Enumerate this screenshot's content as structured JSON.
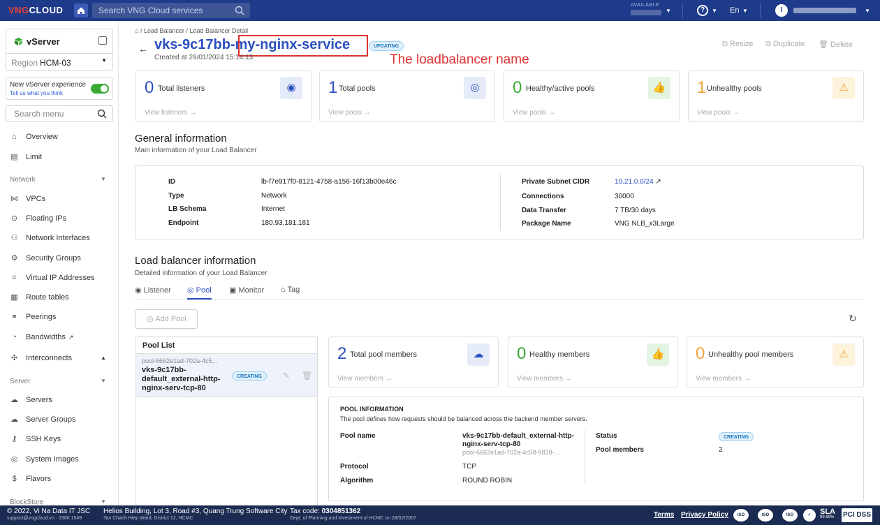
{
  "topbar": {
    "logo_a": "VNG",
    "logo_b": "CLOUD",
    "search_placeholder": "Search VNG Cloud services",
    "available_label": "AVAILABLE",
    "help": "?",
    "lang": "En",
    "avatar_initial": "I"
  },
  "sidebar": {
    "service_name": "vServer",
    "region_label": "Region",
    "region_value": "HCM-03",
    "new_exp_title": "New vServer experience",
    "new_exp_link": "Tell us what you think",
    "search_placeholder": "Search menu",
    "overview": "Overview",
    "limit": "Limit",
    "network_section": "Network",
    "network_items": [
      "VPCs",
      "Floating IPs",
      "Network Interfaces",
      "Security Groups",
      "Virtual IP Addresses",
      "Route tables",
      "Peerings",
      "Bandwidths",
      "Interconnects"
    ],
    "server_section": "Server",
    "server_items": [
      "Servers",
      "Server Groups",
      "SSH Keys",
      "System Images",
      "Flavors"
    ],
    "blockstore_section": "BlockStore"
  },
  "header": {
    "breadcrumb_1": "Load Balancer",
    "breadcrumb_2": "Load Balancer Detail",
    "title": "vks-9c17bb-my-nginx-service",
    "status": "UPDATING",
    "annotation": "The loadbalancer name",
    "created": "Created at 29/01/2024 15:14:13",
    "resize": "Resize",
    "duplicate": "Duplicate",
    "delete": "Delete"
  },
  "stats": [
    {
      "value": "0",
      "label": "Total listeners",
      "link": "View listeners"
    },
    {
      "value": "1",
      "label": "Total pools",
      "link": "View pools"
    },
    {
      "value": "0",
      "label": "Healthy/active pools",
      "link": "View pools"
    },
    {
      "value": "1",
      "label": "Unhealthy pools",
      "link": "View pools"
    }
  ],
  "general": {
    "title": "General information",
    "subtitle": "Main information of your Load Balancer",
    "id_label": "ID",
    "id_value": "lb-f7e917f0-8121-4758-a156-16f13b00e46c",
    "type_label": "Type",
    "type_value": "Network",
    "schema_label": "LB Schema",
    "schema_value": "Internet",
    "endpoint_label": "Endpoint",
    "endpoint_value": "180.93.181.181",
    "cidr_label": "Private Subnet CIDR",
    "cidr_value": "10.21.0.0/24",
    "conn_label": "Connections",
    "conn_value": "30000",
    "transfer_label": "Data Transfer",
    "transfer_value": "7 TB/30 days",
    "package_label": "Package Name",
    "package_value": "VNG NLB_x3Large"
  },
  "lbinfo": {
    "title": "Load balancer information",
    "subtitle": "Detailed information of your Load Balancer",
    "tabs": [
      "Listener",
      "Pool",
      "Monitor",
      "Tag"
    ],
    "add_pool": "Add Pool"
  },
  "poollist": {
    "header": "Pool List",
    "item_id": "pool-6662e1ad-702a-4c5...",
    "item_name": "vks-9c17bb-default_external-http-nginx-serv-tcp-80",
    "item_status": "CREATING"
  },
  "pool_stats": [
    {
      "value": "2",
      "label": "Total pool members",
      "link": "View members"
    },
    {
      "value": "0",
      "label": "Healthy members",
      "link": "View members"
    },
    {
      "value": "0",
      "label": "Unhealthy pool members",
      "link": "View members"
    }
  ],
  "pool_info": {
    "title": "POOL INFORMATION",
    "subtitle": "The pool defines how requests should be balanced across the backend member servers.",
    "name_label": "Pool name",
    "name_value": "vks-9c17bb-default_external-http-nginx-serv-tcp-80",
    "name_id": "pool-6662e1ad-702a-4c58-9828-...",
    "protocol_label": "Protocol",
    "protocol_value": "TCP",
    "algorithm_label": "Algorithm",
    "algorithm_value": "ROUND ROBIN",
    "status_label": "Status",
    "status_value": "CREATING",
    "members_label": "Pool members",
    "members_value": "2"
  },
  "footer": {
    "copyright": "© 2022, Vi Na Data IT JSC",
    "contact": "support@vngcloud.vn · 1900 1549",
    "address": "Helios Building, Lot 3, Road #3, Quang Trung Software City",
    "address_sub": "Tan Chanh Hiep Ward, District 12, HCMC",
    "tax_label": "Tax code:",
    "tax_value": "0304851362",
    "tax_sub": "Dept. of Planning and Investment of HCMC on 28/02/2007",
    "terms": "Terms",
    "privacy": "Privacy Policy",
    "iso": "ISO",
    "sla": "SLA",
    "sla_pct": "99.99%",
    "pci": "PCI DSS"
  },
  "colors": {
    "topbar": "#1e3b8b",
    "accent": "#2b4fbf",
    "green": "#3aaa35",
    "orange": "#f2a33a",
    "annotation_red": "#e03131"
  }
}
